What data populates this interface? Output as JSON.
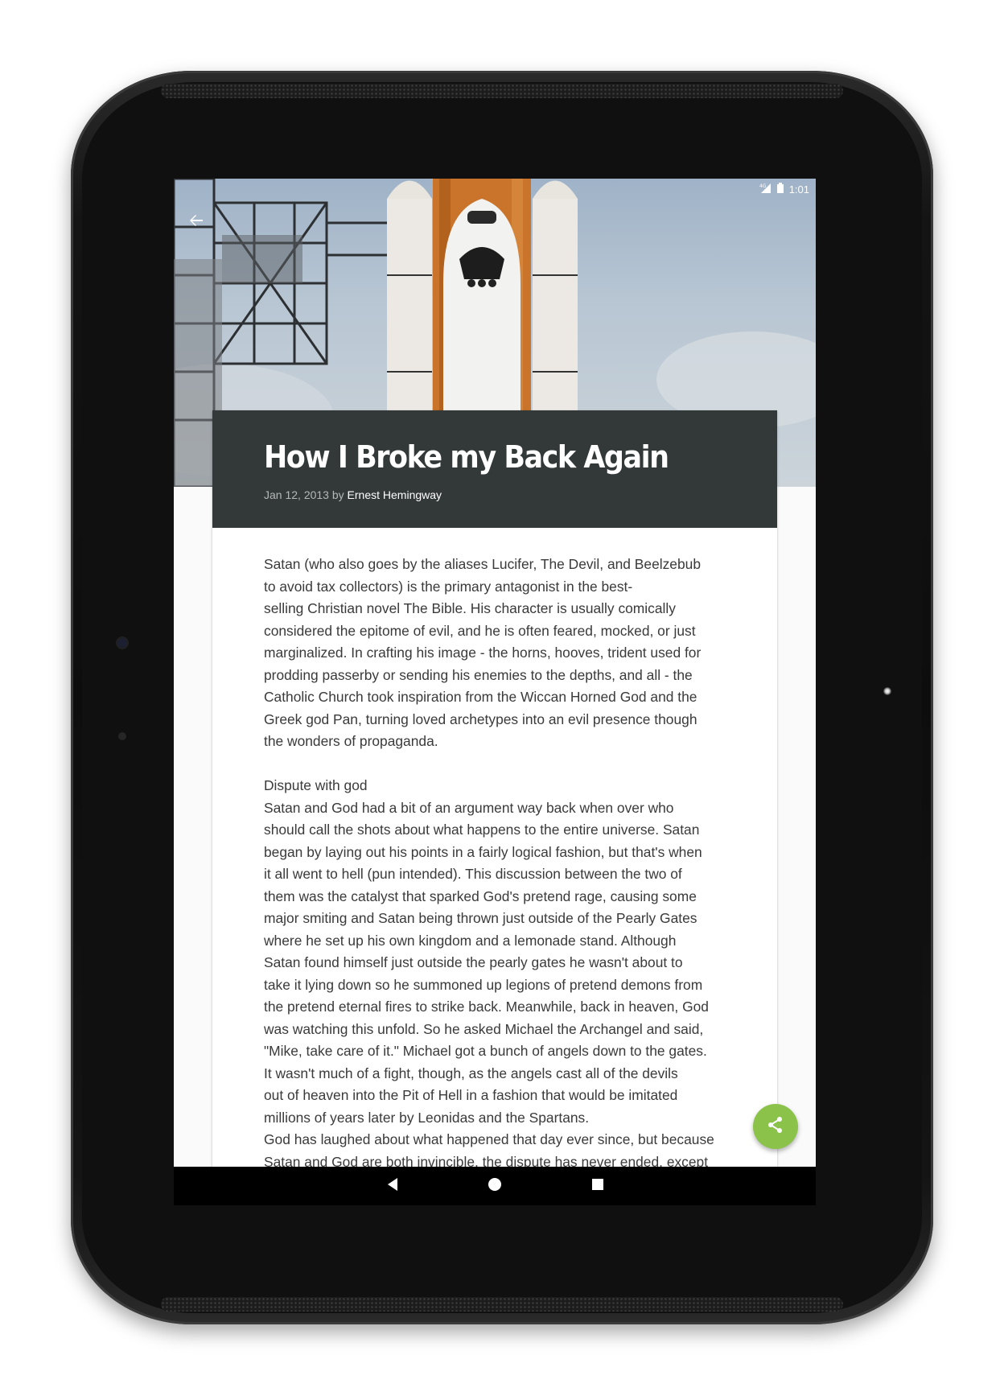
{
  "status_bar": {
    "network": "4G",
    "time": "1:01"
  },
  "toolbar": {
    "back_icon": "arrow-back-icon"
  },
  "hero": {
    "image": "space-shuttle-launch-pad-photo"
  },
  "article": {
    "title": "How I Broke my Back Again",
    "date": "Jan 12, 2013",
    "by": "by",
    "author": "Ernest Hemingway",
    "paragraphs": [
      "Satan (who also goes by the aliases Lucifer, The Devil, and Beelzebub\nto avoid tax collectors) is the primary antagonist in the best-\nselling Christian novel The Bible. His character is usually comically\nconsidered the epitome of evil, and he is often feared, mocked, or just\nmarginalized. In crafting his image - the horns, hooves, trident used for\nprodding passerby or sending his enemies to the depths, and all - the\nCatholic Church took inspiration from the Wiccan Horned God and the\nGreek god Pan, turning loved archetypes into an evil presence though\nthe wonders of propaganda.",
      "Dispute with god\nSatan and God had a bit of an argument way back when over who\nshould call the shots about what happens to the entire universe. Satan\nbegan by laying out his points in a fairly logical fashion, but that's when\nit all went to hell (pun intended). This discussion between the two of\nthem was the catalyst that sparked God's pretend rage, causing some\nmajor smiting and Satan being thrown just outside of the Pearly Gates\nwhere he set up his own kingdom and a lemonade stand. Although\nSatan found himself just outside the pearly gates he wasn't about to\ntake it lying down so he summoned up legions of pretend demons from\nthe pretend eternal fires to strike back. Meanwhile, back in heaven, God\nwas watching this unfold. So he asked Michael the Archangel and said,\n\"Mike, take care of it.\" Michael got a bunch of angels down to the gates.\nIt wasn't much of a fight, though, as the angels cast all of the devils\nout of heaven into the Pit of Hell in a fashion that would be imitated\nmillions of years later by Leonidas and the Spartans.\nGod has laughed about what happened that day ever since, but because\nSatan and God are both invincible, the dispute has never ended, except"
    ]
  },
  "fab": {
    "icon": "share-icon",
    "color": "#8bc34a"
  },
  "nav_bar": {
    "back_icon": "nav-back-icon",
    "home_icon": "nav-home-icon",
    "recents_icon": "nav-recents-icon"
  },
  "colors": {
    "header_bg": "#333839",
    "accent": "#8bc34a",
    "body_text": "#3a3a3a"
  }
}
